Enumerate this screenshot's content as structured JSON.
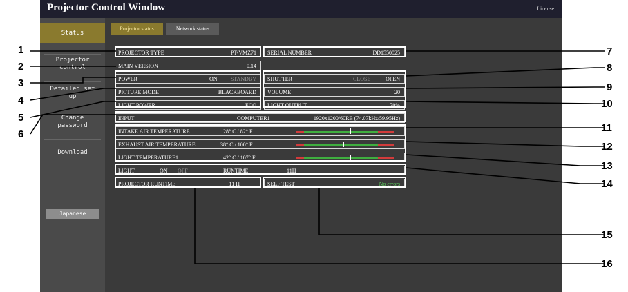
{
  "window": {
    "title": "Projector Control Window",
    "license": "License"
  },
  "sidebar": {
    "items": [
      {
        "label": "Status"
      },
      {
        "label": "Projector control"
      },
      {
        "label": "Detailed set up"
      },
      {
        "label": "Change password"
      },
      {
        "label": "Download"
      }
    ],
    "language_button": "Japanese"
  },
  "tabs": [
    {
      "label": "Projector status"
    },
    {
      "label": "Network status"
    }
  ],
  "status": {
    "projector_type": {
      "label": "PROJECTOR TYPE",
      "value": "PT-VMZ71"
    },
    "serial_number": {
      "label": "SERIAL NUMBER",
      "value": "DD1550025"
    },
    "main_version": {
      "label": "MAIN VERSION",
      "value": "0.14"
    },
    "power": {
      "label": "POWER",
      "on": "ON",
      "standby": "STANDBY"
    },
    "shutter": {
      "label": "SHUTTER",
      "close": "CLOSE",
      "open": "OPEN"
    },
    "picture_mode": {
      "label": "PICTURE MODE",
      "value": "BLACKBOARD"
    },
    "volume": {
      "label": "VOLUME",
      "value": "20"
    },
    "light_power": {
      "label": "LIGHT POWER",
      "value": "ECO"
    },
    "light_output": {
      "label": "LIGHT OUTPUT",
      "value": "70%"
    },
    "input": {
      "label": "INPUT",
      "value": "COMPUTER1",
      "signal": "1920x1200/60RB (74.07kHz/59.95Hz)"
    },
    "intake_temp": {
      "label": "INTAKE AIR TEMPERATURE",
      "value": "28° C / 82° F",
      "level": 0.55
    },
    "exhaust_temp": {
      "label": "EXHAUST AIR TEMPERATURE",
      "value": "38° C / 100° F",
      "level": 0.48
    },
    "light_temp": {
      "label": "LIGHT TEMPERATURE1",
      "value": "42° C / 107° F",
      "level": 0.55
    },
    "light": {
      "label": "LIGHT",
      "on": "ON",
      "off": "OFF",
      "runtime_label": "RUNTIME",
      "runtime_value": "11H"
    },
    "projector_runtime": {
      "label": "PROJECTOR RUNTIME",
      "value": "11 H"
    },
    "self_test": {
      "label": "SELF TEST",
      "value": "No errors"
    }
  },
  "callouts": [
    "1",
    "2",
    "3",
    "4",
    "5",
    "6",
    "7",
    "8",
    "9",
    "10",
    "11",
    "12",
    "13",
    "14",
    "15",
    "16"
  ],
  "colors": {
    "accent": "#8a7a2e",
    "ok": "#5fd45f",
    "bar_green": "#3fae3f",
    "bar_red": "#d23b3b"
  }
}
